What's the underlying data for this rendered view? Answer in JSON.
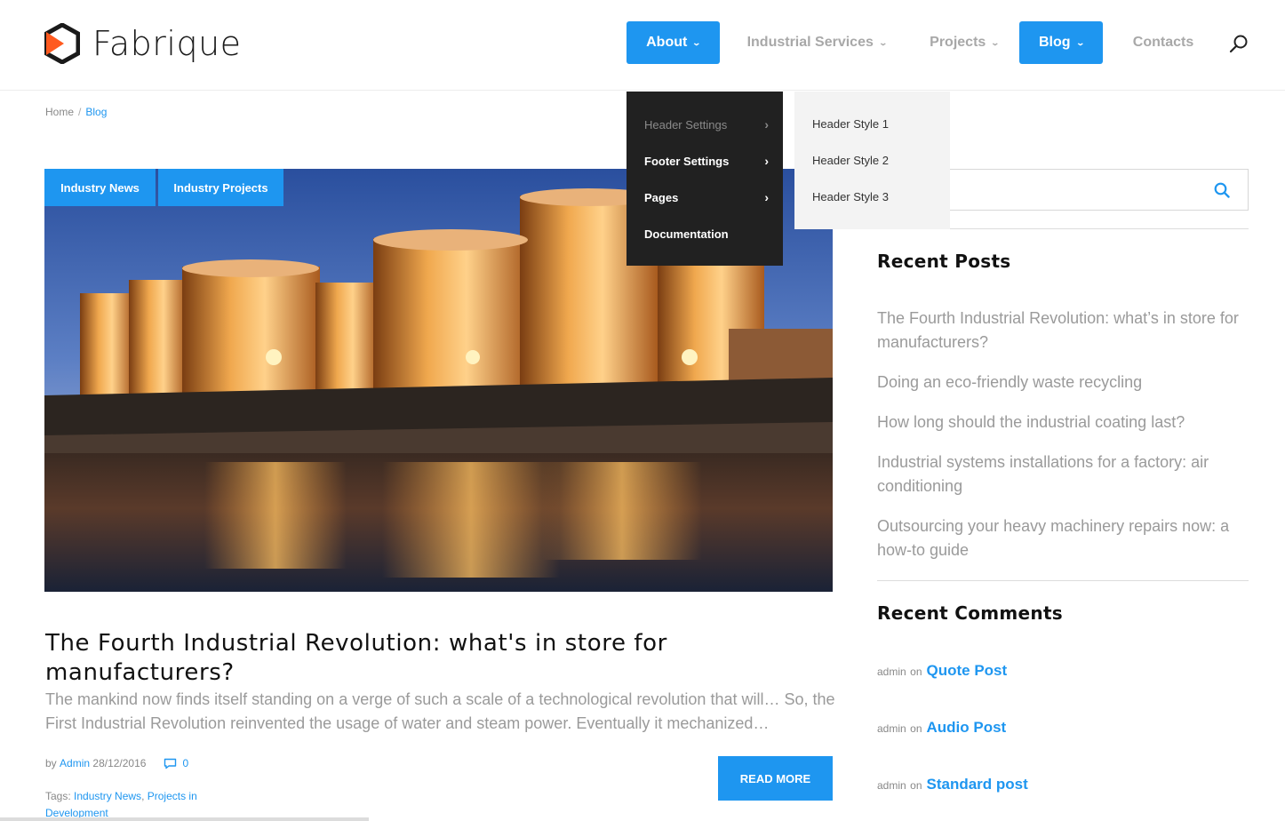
{
  "brand": {
    "name": "Fabrique",
    "accent": "#1e96f0",
    "logo_color": "#ff5a1f"
  },
  "nav": {
    "items": [
      {
        "label": "About",
        "active": true
      },
      {
        "label": "Industrial Services",
        "active": false
      },
      {
        "label": "Projects",
        "active": false
      },
      {
        "label": "Blog",
        "active": true
      },
      {
        "label": "Contacts",
        "active": false
      }
    ],
    "search_icon": "search-icon"
  },
  "dropdown": {
    "items": [
      {
        "label": "Header Settings"
      },
      {
        "label": "Footer Settings"
      },
      {
        "label": "Pages"
      },
      {
        "label": "Documentation"
      }
    ],
    "submenu": [
      "Header Style 1",
      "Header Style 2",
      "Header Style 3"
    ]
  },
  "breadcrumb": {
    "home": "Home",
    "separator": "/",
    "current": "Blog"
  },
  "post": {
    "categories": [
      "Industry News",
      "Industry Projects"
    ],
    "title": "The Fourth Industrial Revolution: what's in store for manufacturers?",
    "excerpt": "The mankind now finds itself standing on a verge of such a scale of a technological  revolution that will… So, the First Industrial Revolution reinvented the usage of water and steam power. Eventually it mechanized…",
    "by": "by",
    "author": "Admin",
    "date": "28/12/2016",
    "comments": "0",
    "tags_label": "Tags:",
    "tags": [
      "Industry News",
      "Projects in Development"
    ],
    "read_more": "READ MORE"
  },
  "sidebar": {
    "search_placeholder": "",
    "recent_posts_title": "Recent Posts",
    "recent_posts": [
      "The Fourth Industrial Revolution: what’s in store for manufacturers?",
      "Doing an eco-friendly waste recycling",
      "How long should the industrial coating last?",
      "Industrial systems installations for a factory: air conditioning",
      "Outsourcing your heavy machinery repairs now: a how-to guide"
    ],
    "recent_comments_title": "Recent Comments",
    "recent_comments": [
      {
        "author": "admin",
        "on": "on",
        "post": "Quote Post"
      },
      {
        "author": "admin",
        "on": "on",
        "post": "Audio Post"
      },
      {
        "author": "admin",
        "on": "on",
        "post": "Standard post"
      }
    ]
  }
}
